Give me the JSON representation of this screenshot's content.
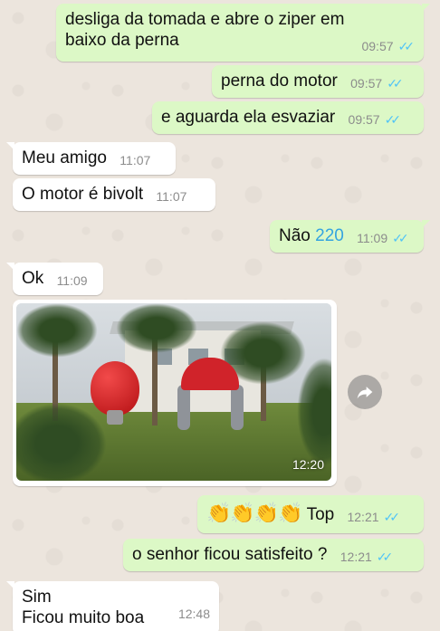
{
  "messages": [
    {
      "text_line1": "desliga da tomada e abre o ziper em",
      "text_line2": "baixo da perna",
      "time": "09:57",
      "status": "read"
    },
    {
      "text": "perna do motor",
      "time": "09:57",
      "status": "read"
    },
    {
      "text": "e aguarda ela esvaziar",
      "time": "09:57",
      "status": "read"
    },
    {
      "text": "Meu amigo",
      "time": "11:07"
    },
    {
      "text": "O motor é bivolt",
      "time": "11:07"
    },
    {
      "text_prefix": "Não",
      "text_link": "220",
      "time": "11:09",
      "status": "read"
    },
    {
      "text": "Ok",
      "time": "11:09"
    },
    {
      "image_alt": "photo",
      "time": "12:20"
    },
    {
      "emoji": [
        "👏",
        "👏",
        "👏",
        "👏"
      ],
      "text": "Top",
      "time": "12:21",
      "status": "read"
    },
    {
      "text": "o senhor ficou satisfeito ?",
      "time": "12:21",
      "status": "read"
    },
    {
      "text_line1": "Sim",
      "text_line2": "Ficou muito boa",
      "time": "12:48"
    }
  ],
  "icons": {
    "read_ticks": "double-check-icon",
    "share": "share-arrow-icon",
    "clap": "clapping-hands-emoji"
  },
  "colors": {
    "outgoing_bubble": "#dcf8c6",
    "incoming_bubble": "#ffffff",
    "read_ticks": "#4fc3f7",
    "link": "#34a4e0",
    "background": "#ece5dd"
  }
}
